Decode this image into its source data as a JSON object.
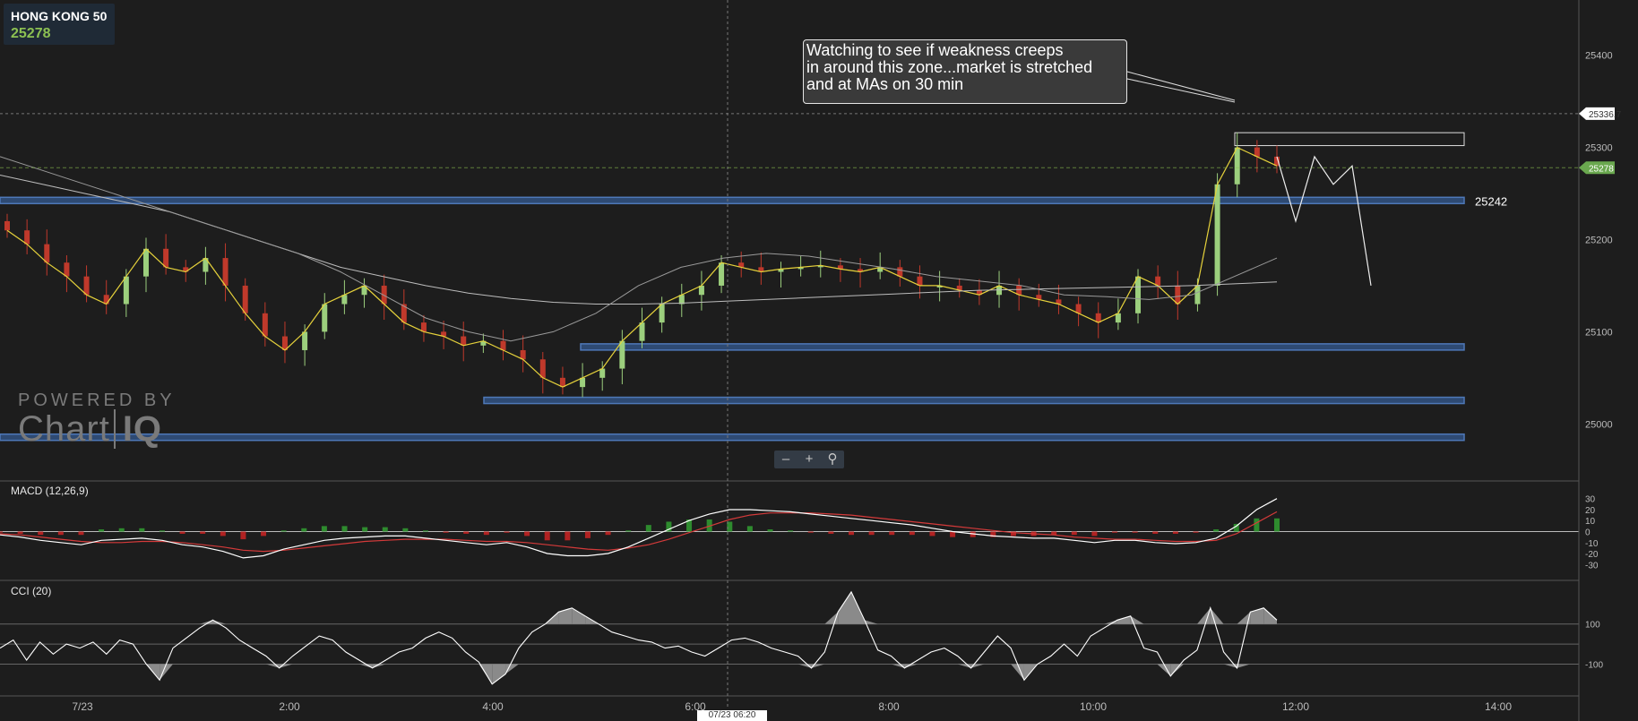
{
  "ticker": {
    "symbol": "HONG KONG 50",
    "price": "25278"
  },
  "annotation": {
    "lines": [
      "Watching to see if weakness creeps",
      "in around this zone...market is stretched",
      "and at MAs on 30 min"
    ]
  },
  "watermark": {
    "powered": "POWERED BY",
    "brand_a": "Chart",
    "brand_b": "IQ"
  },
  "zoom": {
    "minus": "–",
    "plus": "+",
    "reset_icon": "zoom-icon"
  },
  "indicators": {
    "macd": "MACD (12,26,9)",
    "cci": "CCI (20)"
  },
  "crosshair_date": "07/23 06:20",
  "colors": {
    "background": "#1d1d1d",
    "up": "#9ccf7d",
    "down": "#c0392b",
    "level": "#4e78b8",
    "ema": "#e6d23b",
    "sma": "#bdbdbd",
    "price_tag": "#6aa84f"
  },
  "chart_data": [
    {
      "type": "candlestick",
      "title": "HONG KONG 50",
      "y_ticks": [
        25000,
        25100,
        25200,
        25300,
        25400
      ],
      "ylim": [
        24940,
        25460
      ],
      "x_ticks": [
        "7/23",
        "2:00",
        "4:00",
        "6:00",
        "8:00",
        "10:00",
        "12:00",
        "14:00"
      ],
      "price_labels": {
        "last": "25278",
        "crosshair": "25336.7",
        "level": "25242"
      },
      "levels": [
        25242,
        25083,
        25025,
        24985
      ],
      "resistance_box": [
        25302,
        25316
      ],
      "close_path": [
        25210,
        25195,
        25175,
        25160,
        25140,
        25130,
        25160,
        25190,
        25170,
        25165,
        25180,
        25150,
        25120,
        25095,
        25080,
        25100,
        25130,
        25140,
        25150,
        25130,
        25110,
        25100,
        25095,
        25085,
        25090,
        25080,
        25070,
        25050,
        25040,
        25050,
        25060,
        25090,
        25110,
        25130,
        25140,
        25150,
        25175,
        25170,
        25165,
        25168,
        25170,
        25172,
        25168,
        25165,
        25170,
        25160,
        25150,
        25150,
        25145,
        25140,
        25150,
        25140,
        25135,
        25130,
        25120,
        25110,
        25120,
        25160,
        25150,
        25130,
        25150,
        25260,
        25300,
        25290,
        25280
      ],
      "projection": [
        25290,
        25220,
        25290,
        25260,
        25280,
        25150
      ],
      "ema_path": [
        25210,
        25195,
        25175,
        25160,
        25140,
        25130,
        25160,
        25190,
        25170,
        25165,
        25180,
        25150,
        25120,
        25095,
        25080,
        25100,
        25130,
        25140,
        25150,
        25130,
        25110,
        25100,
        25095,
        25085,
        25090,
        25080,
        25070,
        25050,
        25040,
        25050,
        25060,
        25090,
        25110,
        25130,
        25140,
        25150,
        25175,
        25170,
        25165,
        25168,
        25170,
        25172,
        25168,
        25165,
        25170,
        25160,
        25150,
        25150,
        25145,
        25140,
        25150,
        25140,
        25135,
        25130,
        25120,
        25110,
        25120,
        25160,
        25150,
        25130,
        25150,
        25260,
        25300,
        25290,
        25280
      ],
      "sma_path": [
        25270,
        25260,
        25250,
        25240,
        25230,
        25215,
        25200,
        25185,
        25170,
        25160,
        25150,
        25142,
        25136,
        25132,
        25130,
        25130,
        25131,
        25133,
        25135,
        25137,
        25139,
        25141,
        25143,
        25145,
        25146,
        25147,
        25148,
        25149,
        25150,
        25152,
        25154
      ],
      "sma2_path": [
        25290,
        25275,
        25260,
        25245,
        25230,
        25215,
        25200,
        25185,
        25165,
        25140,
        25115,
        25100,
        25090,
        25100,
        25120,
        25150,
        25170,
        25180,
        25185,
        25182,
        25175,
        25168,
        25160,
        25155,
        25150,
        25140,
        25138,
        25135,
        25140,
        25160,
        25180
      ]
    },
    {
      "type": "bar",
      "title": "MACD (12,26,9)",
      "y_ticks": [
        30,
        20,
        10,
        0,
        -10,
        -20,
        -30
      ],
      "ylim": [
        -42,
        42
      ],
      "macd_line": [
        -3,
        -5,
        -8,
        -10,
        -12,
        -8,
        -7,
        -6,
        -8,
        -12,
        -14,
        -18,
        -24,
        -22,
        -16,
        -12,
        -8,
        -6,
        -5,
        -4,
        -4,
        -6,
        -8,
        -10,
        -12,
        -10,
        -14,
        -20,
        -22,
        -22,
        -20,
        -14,
        -6,
        2,
        10,
        16,
        20,
        20,
        19,
        18,
        16,
        14,
        12,
        10,
        8,
        6,
        3,
        0,
        -2,
        -4,
        -5,
        -6,
        -6,
        -8,
        -10,
        -8,
        -8,
        -10,
        -11,
        -10,
        -6,
        5,
        20,
        30
      ],
      "signal_line": [
        -2,
        -3,
        -5,
        -7,
        -9,
        -10,
        -10,
        -9,
        -9,
        -10,
        -12,
        -14,
        -17,
        -18,
        -17,
        -15,
        -13,
        -11,
        -9,
        -8,
        -7,
        -7,
        -7,
        -8,
        -9,
        -9,
        -10,
        -12,
        -14,
        -16,
        -17,
        -15,
        -12,
        -7,
        -1,
        5,
        11,
        15,
        17,
        17,
        17,
        16,
        15,
        13,
        11,
        9,
        7,
        5,
        3,
        1,
        -1,
        -2,
        -3,
        -5,
        -6,
        -7,
        -7,
        -8,
        -9,
        -9,
        -8,
        -2,
        8,
        18
      ]
    },
    {
      "type": "area",
      "title": "CCI (20)",
      "y_ticks": [
        100,
        -100
      ],
      "ylim": [
        -250,
        300
      ],
      "values": [
        -20,
        20,
        -80,
        10,
        -50,
        0,
        -20,
        10,
        -50,
        20,
        0,
        -100,
        -180,
        -20,
        30,
        80,
        120,
        80,
        20,
        -20,
        -60,
        -120,
        -60,
        -10,
        40,
        20,
        -40,
        -80,
        -120,
        -80,
        -40,
        -20,
        30,
        60,
        30,
        -40,
        -90,
        -200,
        -150,
        -20,
        60,
        100,
        160,
        180,
        140,
        100,
        60,
        40,
        20,
        10,
        -20,
        -10,
        -40,
        -60,
        -20,
        20,
        30,
        10,
        -20,
        -40,
        -60,
        -120,
        -40,
        160,
        260,
        120,
        -30,
        -60,
        -120,
        -80,
        -40,
        -20,
        -60,
        -120,
        -40,
        40,
        -20,
        -180,
        -100,
        -60,
        0,
        -60,
        40,
        80,
        120,
        140,
        -20,
        -40,
        -160,
        -80,
        -30,
        180,
        -40,
        -120,
        160,
        180,
        120
      ]
    }
  ]
}
